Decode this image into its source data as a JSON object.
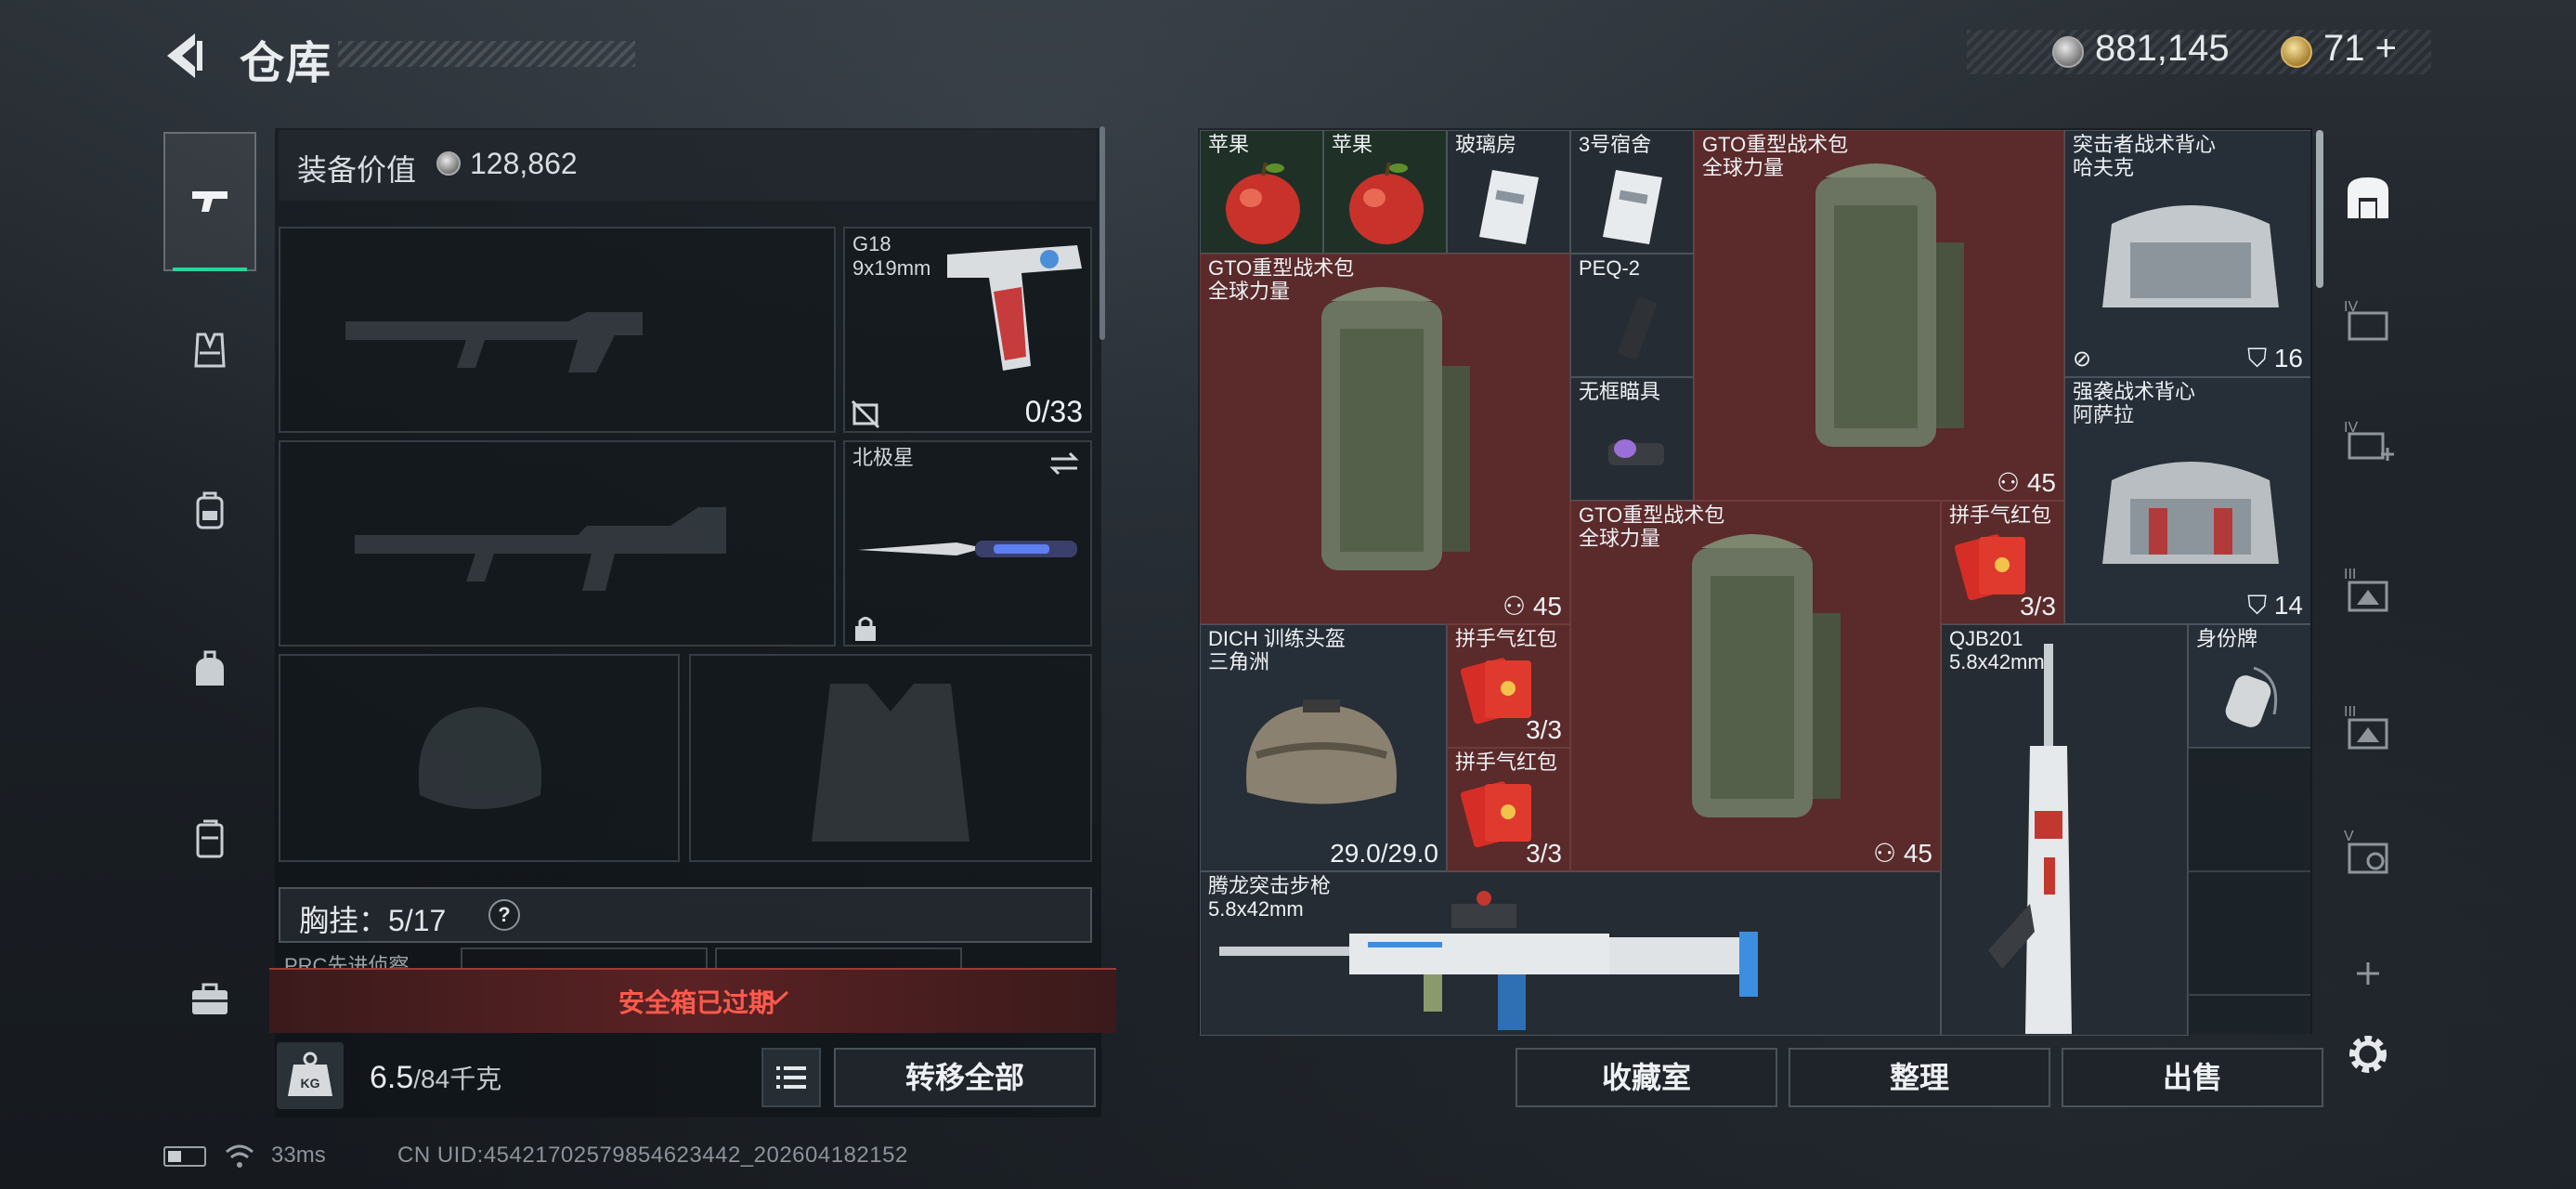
{
  "header": {
    "title": "仓库",
    "money": "881,145",
    "tokens": "71",
    "tokens_plus": "+"
  },
  "sidebar": {
    "items": [
      "pistol-icon",
      "vest-icon",
      "backpack-icon",
      "helmet-bag-icon",
      "case-icon",
      "toolbox-icon"
    ],
    "active": 0
  },
  "loadout": {
    "equip_value_label": "装备价值",
    "equip_value": "128,862",
    "slots": {
      "pistol_name": "G18",
      "pistol_ammo_type": "9x19mm",
      "pistol_ammo": "0/33",
      "melee_name": "北极星"
    },
    "chest_rig": "胸挂：5/17",
    "chest_help": "?",
    "prc_label": "PRC先进侦察",
    "safebox_status": "安全箱已过期",
    "weight_value": "6.5",
    "weight_total": "/84千克",
    "weight_icon_text": "KG",
    "transfer_all": "转移全部"
  },
  "stash": {
    "items": {
      "apple1": "苹果",
      "apple2": "苹果",
      "glass_room": "玻璃房",
      "dorm3": "3号宿舍",
      "gto_top_name": "GTO重型战术包",
      "gto_top_sub": "全球力量",
      "gto_top_count": "45",
      "vest_hafk_name": "突击者战术背心",
      "vest_hafk_sub": "哈夫克",
      "vest_hafk_count": "16",
      "gto_left_name": "GTO重型战术包",
      "gto_left_sub": "全球力量",
      "gto_left_count": "45",
      "peq2": "PEQ-2",
      "frameless_sight": "无框瞄具",
      "vest_asara_name": "强袭战术背心",
      "vest_asara_sub": "阿萨拉",
      "vest_asara_count": "14",
      "gto_mid_name": "GTO重型战术包",
      "gto_mid_sub": "全球力量",
      "gto_mid_count": "45",
      "redpacket1_name": "拼手气红包",
      "redpacket1_count": "3/3",
      "helmet_name": "DICH 训练头盔",
      "helmet_sub": "三角洲",
      "helmet_dur": "29.0/29.0",
      "redpacket2_name": "拼手气红包",
      "redpacket2_count": "3/3",
      "redpacket3_name": "拼手气红包",
      "redpacket3_count": "3/3",
      "qjb_name": "QJB201",
      "qjb_sub": "5.8x42mm",
      "dogtag": "身份牌",
      "rifle_name": "腾龙突击步枪",
      "rifle_sub": "5.8x42mm"
    },
    "buttons": {
      "collection": "收藏室",
      "sort": "整理",
      "sell": "出售"
    },
    "tabs": [
      "home-icon",
      "case-iv-icon",
      "case-iv-add-icon",
      "case-iii-icon",
      "case-iii-b-icon",
      "case-v-icon",
      "add-icon",
      "gear-icon"
    ],
    "tab_labels": [
      "",
      "IV",
      "IV",
      "III",
      "III",
      "V",
      "",
      ""
    ]
  },
  "footer": {
    "ping": "33ms",
    "uid": "CN UID:4542170257985462344​2_202604182152"
  },
  "colors": {
    "accent_green": "#2bd39a",
    "alert_red": "#ff5a4d",
    "item_red_bg": "#5b2a2b"
  }
}
